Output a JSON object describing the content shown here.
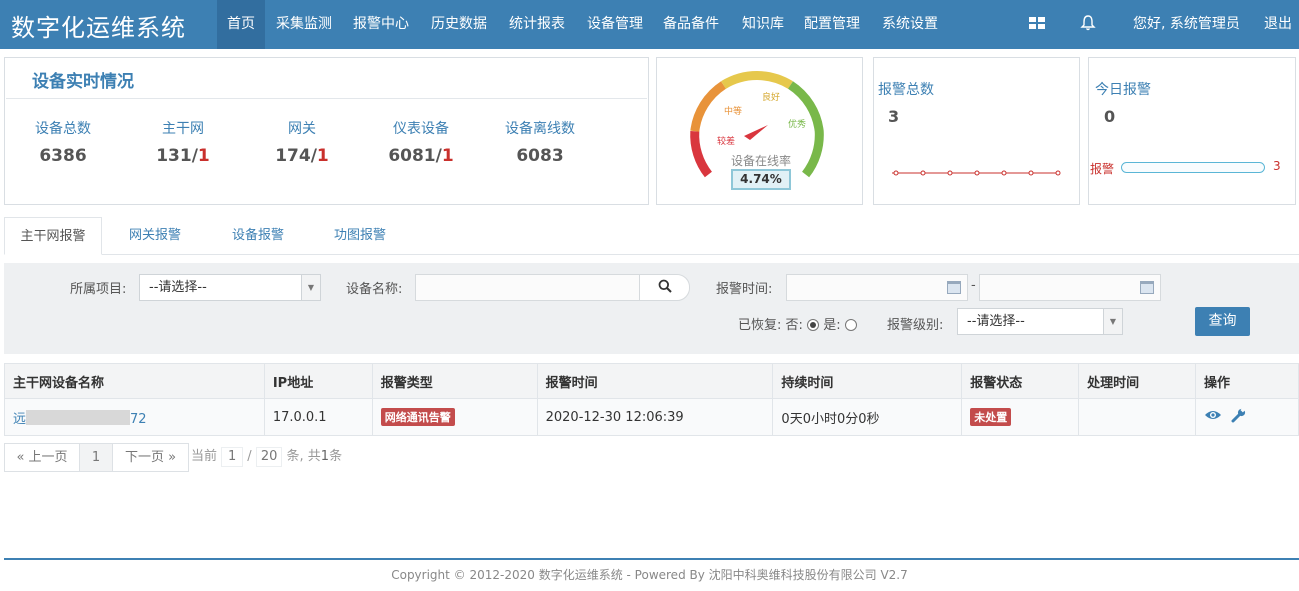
{
  "header": {
    "brand": "数字化运维系统",
    "nav": [
      "首页",
      "采集监测",
      "报警中心",
      "历史数据",
      "统计报表",
      "设备管理",
      "备品备件",
      "知识库",
      "配置管理",
      "系统设置"
    ],
    "greeting": "您好, 系统管理员",
    "logout": "退出",
    "icons": [
      "grid-icon",
      "bell-icon"
    ]
  },
  "realtime": {
    "title": "设备实时情况",
    "stats": [
      {
        "label": "设备总数",
        "value": "6386",
        "alarm": ""
      },
      {
        "label": "主干网",
        "value": "131/",
        "alarm": "1"
      },
      {
        "label": "网关",
        "value": "174/",
        "alarm": "1"
      },
      {
        "label": "仪表设备",
        "value": "6081/",
        "alarm": "1"
      },
      {
        "label": "设备离线数",
        "value": "6083",
        "alarm": ""
      }
    ]
  },
  "gauge": {
    "labels": {
      "poor": "较差",
      "medium": "中等",
      "good": "良好",
      "excellent": "优秀"
    },
    "caption": "设备在线率",
    "percent": "4.74%",
    "level": 0.0474,
    "colors": {
      "poor": "#d9363e",
      "medium": "#e8933a",
      "good": "#e6c84c",
      "excellent": "#79b84a"
    }
  },
  "alarm_total": {
    "title": "报警总数",
    "value": "3"
  },
  "today_alarm": {
    "title": "今日报警",
    "value": "0",
    "bar_label": "报警",
    "bar_count": "3"
  },
  "tabs": [
    "主干网报警",
    "网关报警",
    "设备报警",
    "功图报警"
  ],
  "filter": {
    "project_label": "所属项目:",
    "project_value": "--请选择--",
    "device_label": "设备名称:",
    "device_value": "",
    "time_label": "报警时间:",
    "time_sep": "-",
    "time_from": "",
    "time_to": "",
    "recovered_label": "已恢复: 否:",
    "recovered_yes": "是:",
    "level_label": "报警级别:",
    "level_value": "--请选择--",
    "query": "查询"
  },
  "table": {
    "headers": [
      "主干网设备名称",
      "IP地址",
      "报警类型",
      "报警时间",
      "持续时间",
      "报警状态",
      "处理时间",
      "操作"
    ],
    "rows": [
      {
        "name_prefix": "远",
        "name_suffix": "72",
        "ip": "17.0.0.1",
        "type": "网络通讯告警",
        "time": "2020-12-30 12:06:39",
        "duration": "0天0小时0分0秒",
        "status": "未处置",
        "handled": ""
      }
    ]
  },
  "pager": {
    "prev": "« 上一页",
    "page": "1",
    "next": "下一页 »",
    "info_prefix": "当前",
    "current": "1",
    "sep": "/",
    "size": "20",
    "info_suffix": "条, 共",
    "total": "1",
    "unit": "条"
  },
  "footer": "Copyright © 2012-2020 数字化运维系统 - Powered By 沈阳中科奥维科技股份有限公司 V2.7"
}
